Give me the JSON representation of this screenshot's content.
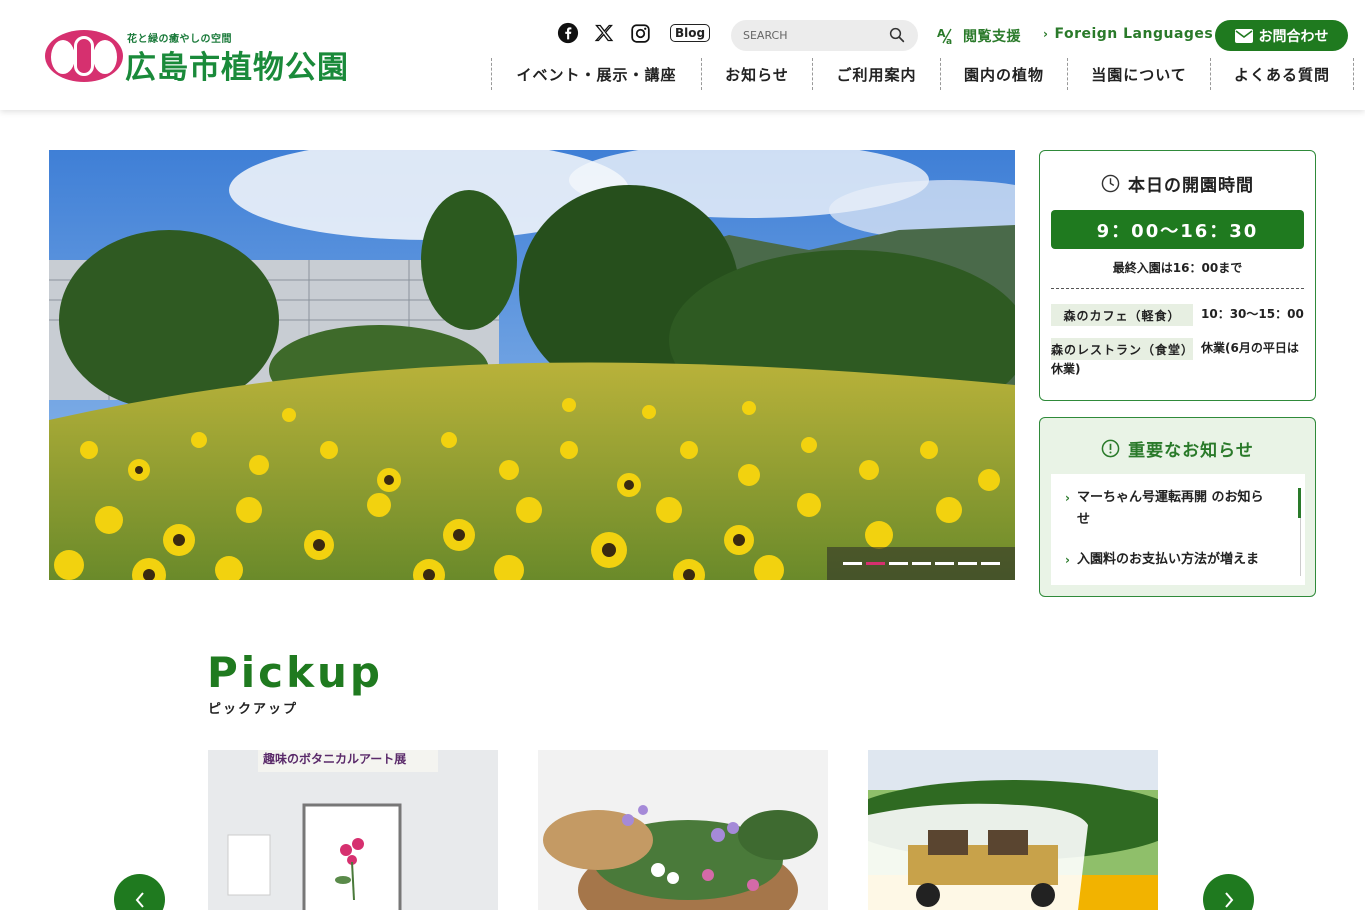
{
  "header": {
    "logo": {
      "tagline": "花と緑の癒やしの空間",
      "name": "広島市植物公園"
    },
    "social": {
      "blog_label": "Blog"
    },
    "search": {
      "placeholder": "SEARCH"
    },
    "accessibility_label": "閲覧支援",
    "foreign_label": "Foreign Languages",
    "contact_label": "お問合わせ",
    "nav": [
      {
        "label": "イベント・展示・講座"
      },
      {
        "label": "お知らせ"
      },
      {
        "label": "ご利用案内"
      },
      {
        "label": "園内の植物"
      },
      {
        "label": "当園について"
      },
      {
        "label": "よくある質問"
      }
    ]
  },
  "hero": {
    "slide_count": 7,
    "active_slide": 2
  },
  "hours": {
    "title": "本日の開園時間",
    "time": "9：00〜16：30",
    "last_entry": "最終入園は16：00まで",
    "facilities": [
      {
        "name": "森のカフェ（軽食）",
        "value": "10：30〜15：00"
      },
      {
        "name": "森のレストラン（食堂）",
        "value_line1": "休業(6月の平日は",
        "value_line2": "休業)"
      }
    ]
  },
  "notices": {
    "title": "重要なお知らせ",
    "items": [
      {
        "line1": "マーちゃん号運転再開 のお知ら",
        "line2": "せ"
      },
      {
        "line1": "入園料のお支払い方法が増えま"
      }
    ]
  },
  "pickup": {
    "title": "Pickup",
    "subtitle": "ピックアップ",
    "cards": [
      {
        "banner": "趣味のボタニカルアート展"
      },
      {
        "banner": ""
      },
      {
        "banner": ""
      }
    ]
  },
  "colors": {
    "accent_green": "#1f7a1f",
    "brand_pink": "#d6306f",
    "panel_green_bg": "#e9f3e6"
  }
}
